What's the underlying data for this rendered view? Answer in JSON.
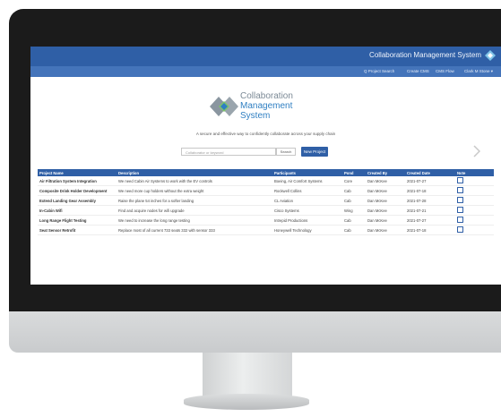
{
  "app": {
    "title": "Collaboration Management System",
    "logo": {
      "line1": "Collaboration",
      "line2": "Management",
      "line3": "System"
    },
    "tagline": "A secure and effective way to confidently collaborate across your supply chain"
  },
  "nav": {
    "items": [
      "Q  Project Search",
      "Create CMS",
      "CMS Flow",
      "Clark M Stone ▾"
    ]
  },
  "search": {
    "placeholder": "Collaborator or keyword",
    "button_label": "Search",
    "new_project_label": "New Project"
  },
  "table": {
    "headers": [
      "Project Name",
      "Description",
      "Participants",
      "Pond",
      "Created By",
      "Created Date",
      "Note"
    ],
    "rows": [
      {
        "name": "Air Filtration System Integration",
        "desc": "We need Cabin Air Systems to work with the EV controls",
        "participants": "Boeing, Air Comfort Systems",
        "pond": "Core",
        "created_by": "Dan McKee",
        "date": "2021-07-27",
        "note": "note-icon"
      },
      {
        "name": "Composite Drink Holder Development",
        "desc": "We need more cup holders without the extra weight",
        "participants": "Rockwell Collins",
        "pond": "Cab",
        "created_by": "Dan McKee",
        "date": "2021-07-18",
        "note": "note-icon"
      },
      {
        "name": "Extend Landing Gear Assembly",
        "desc": "Raise the plane 54 inches for a softer landing",
        "participants": "CL Aviation",
        "pond": "Cab",
        "created_by": "Dan McKee",
        "date": "2021-07-28",
        "note": "note-icon"
      },
      {
        "name": "In-Cabin Wifi",
        "desc": "Find and acquire nodes for wifi upgrade",
        "participants": "Cisco Systems",
        "pond": "Wing",
        "created_by": "Dan McKee",
        "date": "2021-07-21",
        "note": "note-icon"
      },
      {
        "name": "Long Range Flight Testing",
        "desc": "We need to increase the long range testing",
        "participants": "Intrepid Productions",
        "pond": "Cab",
        "created_by": "Dan McKee",
        "date": "2021-07-27",
        "note": "note-icon"
      },
      {
        "name": "Seat Sensor Retrofit",
        "desc": "Replace most of all current 733 seats 332 with sensor 333",
        "participants": "Honeywell Technology",
        "pond": "Cab",
        "created_by": "Dan McKee",
        "date": "2021-07-18",
        "note": "note-icon"
      }
    ]
  },
  "colors": {
    "brand": "#2f5fa6",
    "nav": "#4474ba",
    "accent": "#2f7fc2"
  }
}
